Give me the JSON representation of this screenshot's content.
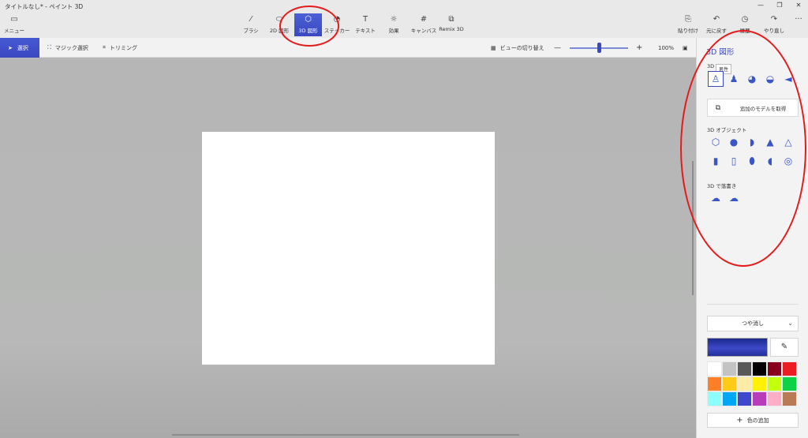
{
  "window": {
    "title": "タイトルなし* - ペイント 3D",
    "controls": [
      "—",
      "❐",
      "✕"
    ]
  },
  "toolbar": {
    "menu": "メニュー",
    "tools": [
      {
        "label": "ブラシ",
        "icon": "brush-icon"
      },
      {
        "label": "2D 図形",
        "icon": "2d-shapes-icon"
      },
      {
        "label": "3D 図形",
        "icon": "3d-shapes-icon"
      },
      {
        "label": "ステッカー",
        "icon": "sticker-icon"
      },
      {
        "label": "テキスト",
        "icon": "text-icon"
      },
      {
        "label": "効果",
        "icon": "effects-icon"
      },
      {
        "label": "キャンバス",
        "icon": "canvas-icon"
      },
      {
        "label": "Remix 3D",
        "icon": "remix-icon"
      }
    ],
    "right": [
      {
        "label": "貼り付け",
        "icon": "paste-icon"
      },
      {
        "label": "元に戻す",
        "icon": "undo-icon"
      },
      {
        "label": "履歴",
        "icon": "history-icon"
      },
      {
        "label": "やり直し",
        "icon": "redo-icon"
      }
    ],
    "more": "···"
  },
  "subbar": {
    "select": "選択",
    "magic_select": "マジック選択",
    "crop": "トリミング",
    "view_toggle": "ビューの切り替え",
    "zoom_minus": "—",
    "zoom_plus": "+",
    "zoom_level": "100%",
    "zoom_percent": 50
  },
  "panel": {
    "title": "3D 図形",
    "models_label": "3D",
    "tooltip": "男性",
    "get_more_models": "追加のモデルを取得",
    "objects_label": "3D オブジェクト",
    "doodle_label": "3D で落書き",
    "finish_label": "つや消し",
    "finish_chevron": "⌄",
    "eyedropper": "✎",
    "add_color": "色の追加",
    "add_plus": "+"
  },
  "palette": [
    "#ffffff",
    "#c3c3c3",
    "#585858",
    "#000000",
    "#88001b",
    "#ec1c24",
    "#ff7f27",
    "#ffca18",
    "#fdeca6",
    "#fff200",
    "#c4ff0e",
    "#0ed145",
    "#8cfffb",
    "#00a8f3",
    "#3f48cc",
    "#b83dba",
    "#ffaec8",
    "#b97a56"
  ],
  "accent": "#3b49c1",
  "annotation_color": "#e41b1b"
}
